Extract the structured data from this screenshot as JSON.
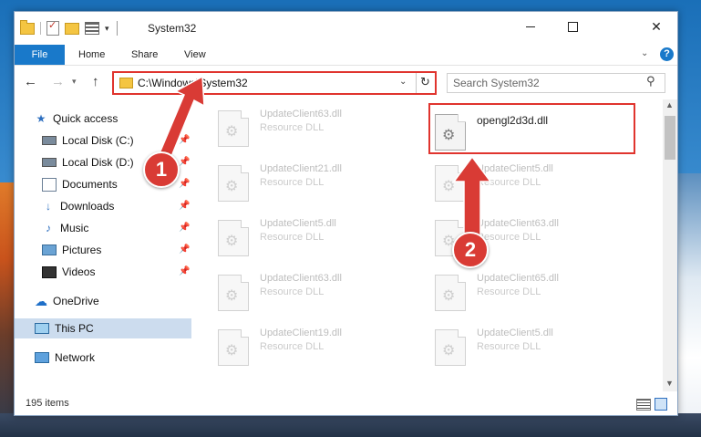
{
  "window": {
    "title": "System32",
    "quick_access_toolbar_icons": [
      "folder-icon",
      "properties-icon",
      "new-folder-icon",
      "view-icon",
      "dropdown-icon"
    ]
  },
  "ribbon": {
    "tabs": [
      {
        "label": "File",
        "active": true
      },
      {
        "label": "Home"
      },
      {
        "label": "Share"
      },
      {
        "label": "View"
      }
    ]
  },
  "address_bar": {
    "path": "C:\\Windows\\System32"
  },
  "search": {
    "placeholder": "Search System32"
  },
  "navigation": {
    "items": [
      {
        "label": "Quick access",
        "icon": "star-icon"
      },
      {
        "label": "Local Disk (C:)",
        "icon": "drive-icon",
        "pinned": true
      },
      {
        "label": "Local Disk (D:)",
        "icon": "drive-icon",
        "pinned": true
      },
      {
        "label": "Documents",
        "icon": "document-icon",
        "pinned": true
      },
      {
        "label": "Downloads",
        "icon": "download-icon",
        "pinned": true
      },
      {
        "label": "Music",
        "icon": "music-icon",
        "pinned": true
      },
      {
        "label": "Pictures",
        "icon": "picture-icon",
        "pinned": true
      },
      {
        "label": "Videos",
        "icon": "video-icon",
        "pinned": true
      },
      {
        "label": "OneDrive",
        "icon": "cloud-icon"
      },
      {
        "label": "This PC",
        "icon": "computer-icon",
        "selected": true
      },
      {
        "label": "Network",
        "icon": "network-icon"
      }
    ]
  },
  "files": {
    "left_column": [
      {
        "name": "UpdateClient63.dll",
        "type": "Resource DLL"
      },
      {
        "name": "UpdateClient21.dll",
        "type": "Resource DLL"
      },
      {
        "name": "UpdateClient5.dll",
        "type": "Resource DLL"
      },
      {
        "name": "UpdateClient63.dll",
        "type": "Resource DLL"
      },
      {
        "name": "UpdateClient19.dll",
        "type": "Resource DLL"
      }
    ],
    "right_column": [
      {
        "name": "opengl2d3d.dll",
        "type": "",
        "highlighted": true
      },
      {
        "name": "UpdateClient5.dll",
        "type": "Resource DLL"
      },
      {
        "name": "UpdateClient63.dll",
        "type": "Resource DLL"
      },
      {
        "name": "UpdateClient65.dll",
        "type": "Resource DLL"
      },
      {
        "name": "UpdateClient5.dll",
        "type": "Resource DLL"
      }
    ]
  },
  "status_bar": {
    "item_count": "195 items"
  },
  "annotations": {
    "step1": "1",
    "step2": "2",
    "color": "#e0342e"
  },
  "colors": {
    "accent": "#1979ca",
    "selection": "#ccdcee"
  }
}
